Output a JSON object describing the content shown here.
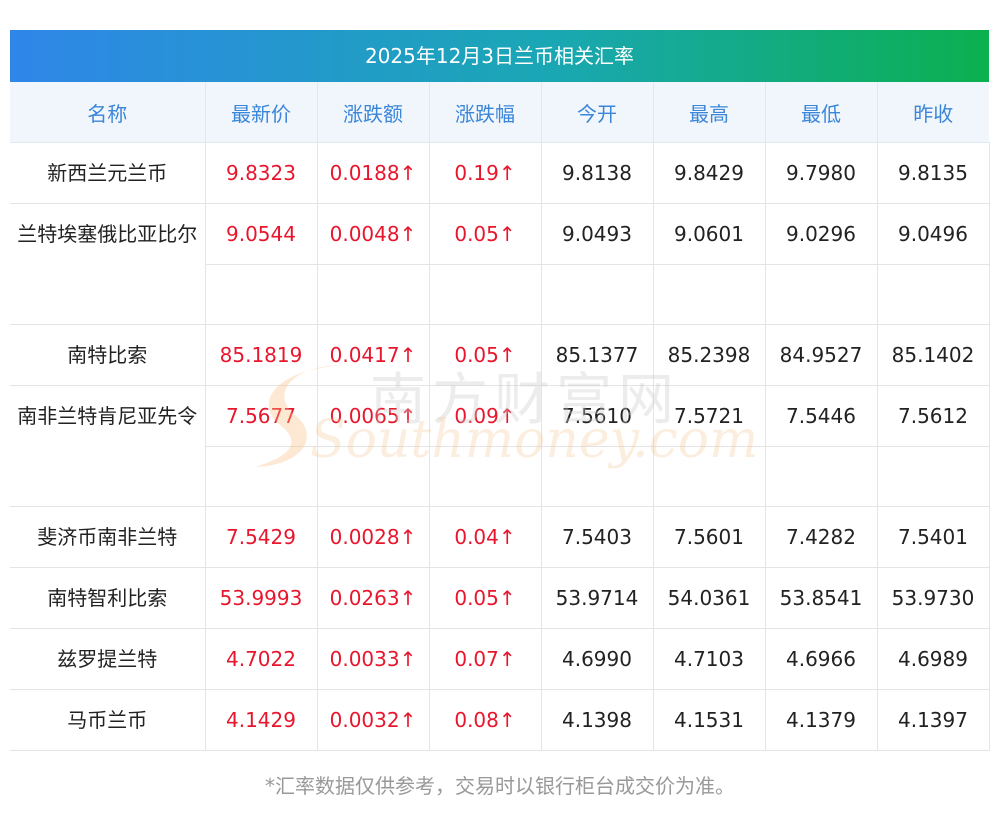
{
  "title": "2025年12月3日兰币相关汇率",
  "headers": [
    "名称",
    "最新价",
    "涨跌额",
    "涨跌幅",
    "今开",
    "最高",
    "最低",
    "昨收"
  ],
  "rows": [
    {
      "name": "新西兰元兰币",
      "latest": "9.8323",
      "change": "0.0188↑",
      "pct": "0.19↑",
      "open": "9.8138",
      "high": "9.8429",
      "low": "9.7980",
      "prev": "9.8135"
    },
    {
      "name": "兰特埃塞俄比亚比尔",
      "latest": "9.0544",
      "change": "0.0048↑",
      "pct": "0.05↑",
      "open": "9.0493",
      "high": "9.0601",
      "low": "9.0296",
      "prev": "9.0496"
    },
    {
      "name": "南特比索",
      "latest": "85.1819",
      "change": "0.0417↑",
      "pct": "0.05↑",
      "open": "85.1377",
      "high": "85.2398",
      "low": "84.9527",
      "prev": "85.1402"
    },
    {
      "name": "南非兰特肯尼亚先令",
      "latest": "7.5677",
      "change": "0.0065↑",
      "pct": "0.09↑",
      "open": "7.5610",
      "high": "7.5721",
      "low": "7.5446",
      "prev": "7.5612"
    },
    {
      "name": "斐济币南非兰特",
      "latest": "7.5429",
      "change": "0.0028↑",
      "pct": "0.04↑",
      "open": "7.5403",
      "high": "7.5601",
      "low": "7.4282",
      "prev": "7.5401"
    },
    {
      "name": "南特智利比索",
      "latest": "53.9993",
      "change": "0.0263↑",
      "pct": "0.05↑",
      "open": "53.9714",
      "high": "54.0361",
      "low": "53.8541",
      "prev": "53.9730"
    },
    {
      "name": "兹罗提兰特",
      "latest": "4.7022",
      "change": "0.0033↑",
      "pct": "0.07↑",
      "open": "4.6990",
      "high": "4.7103",
      "low": "4.6966",
      "prev": "4.6989"
    },
    {
      "name": "马币兰币",
      "latest": "4.1429",
      "change": "0.0032↑",
      "pct": "0.08↑",
      "open": "4.1398",
      "high": "4.1531",
      "low": "4.1379",
      "prev": "4.1397"
    }
  ],
  "footnote": "*汇率数据仅供参考，交易时以银行柜台成交价为准。",
  "watermark": {
    "cn": "南方财富网",
    "en": "Southmoney.com"
  },
  "colors": {
    "up": "#e8162d",
    "header_text": "#3a86d8",
    "header_bg": "#f1f6fc",
    "title_start": "#2f86e9",
    "title_end": "#0bb04f"
  }
}
